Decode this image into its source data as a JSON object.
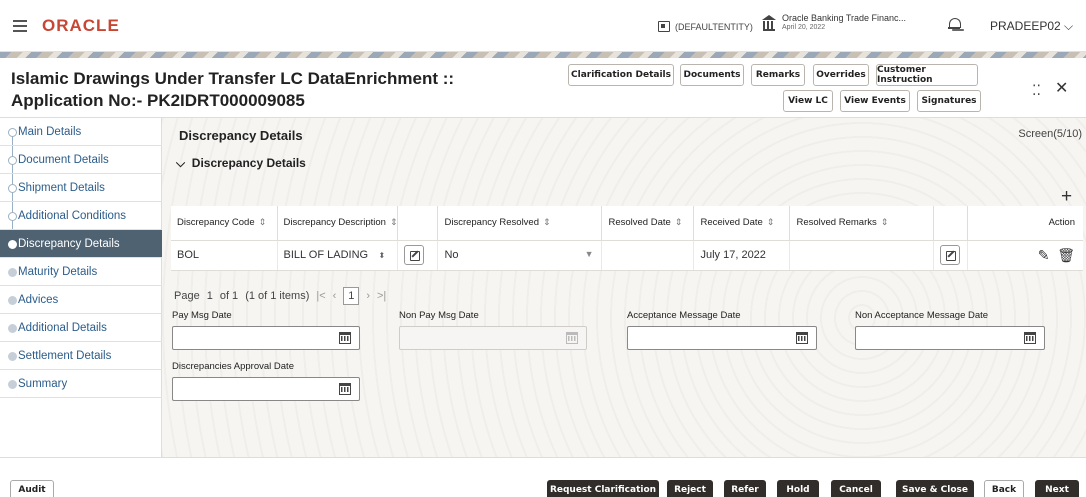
{
  "topbar": {
    "logo": "ORACLE",
    "entity": "(DEFAULTENTITY)",
    "bank_name": "Oracle Banking Trade Financ...",
    "bank_date": "April 20, 2022",
    "user": "PRADEEP02 ⌵"
  },
  "header": {
    "title_line1": "Islamic Drawings Under Transfer LC DataEnrichment ::",
    "title_line2": "Application No:- PK2IDRT000009085",
    "buttons": {
      "clarification": "Clarification Details",
      "documents": "Documents",
      "remarks": "Remarks",
      "overrides": "Overrides",
      "customer_instruction": "Customer Instruction",
      "view_lc": "View LC",
      "view_events": "View Events",
      "signatures": "Signatures"
    }
  },
  "sidebar": {
    "items": [
      {
        "label": "Main Details"
      },
      {
        "label": "Document Details"
      },
      {
        "label": "Shipment Details"
      },
      {
        "label": "Additional Conditions"
      },
      {
        "label": "Discrepancy Details"
      },
      {
        "label": "Maturity Details"
      },
      {
        "label": "Advices"
      },
      {
        "label": "Additional Details"
      },
      {
        "label": "Settlement Details"
      },
      {
        "label": "Summary"
      }
    ]
  },
  "main": {
    "section_title": "Discrepancy Details",
    "screen": "Screen(5/10)",
    "sub_section": "Discrepancy Details",
    "columns": {
      "code": "Discrepancy Code",
      "description": "Discrepancy Description",
      "resolved": "Discrepancy Resolved",
      "resolved_date": "Resolved Date",
      "received_date": "Received Date",
      "remarks": "Resolved Remarks",
      "action": "Action"
    },
    "row": {
      "code": "BOL",
      "description": "BILL OF LADING NOT SUBMITTED AS PART",
      "resolved": "No",
      "resolved_date": "",
      "received_date": "July 17, 2022",
      "remarks": ""
    },
    "pager": {
      "page_label": "Page",
      "page": "1",
      "of": "of 1",
      "items": "(1 of 1 items)",
      "current": "1"
    },
    "fields": {
      "pay_msg_date": "Pay Msg Date",
      "non_pay_msg_date": "Non Pay Msg Date",
      "acceptance_msg_date": "Acceptance Message Date",
      "non_acceptance_msg_date": "Non Acceptance Message Date",
      "discrepancies_approval_date": "Discrepancies Approval Date"
    }
  },
  "footer": {
    "audit": "Audit",
    "request_clarification": "Request Clarification",
    "reject": "Reject",
    "refer": "Refer",
    "hold": "Hold",
    "cancel": "Cancel",
    "save_close": "Save & Close",
    "back": "Back",
    "next": "Next"
  }
}
